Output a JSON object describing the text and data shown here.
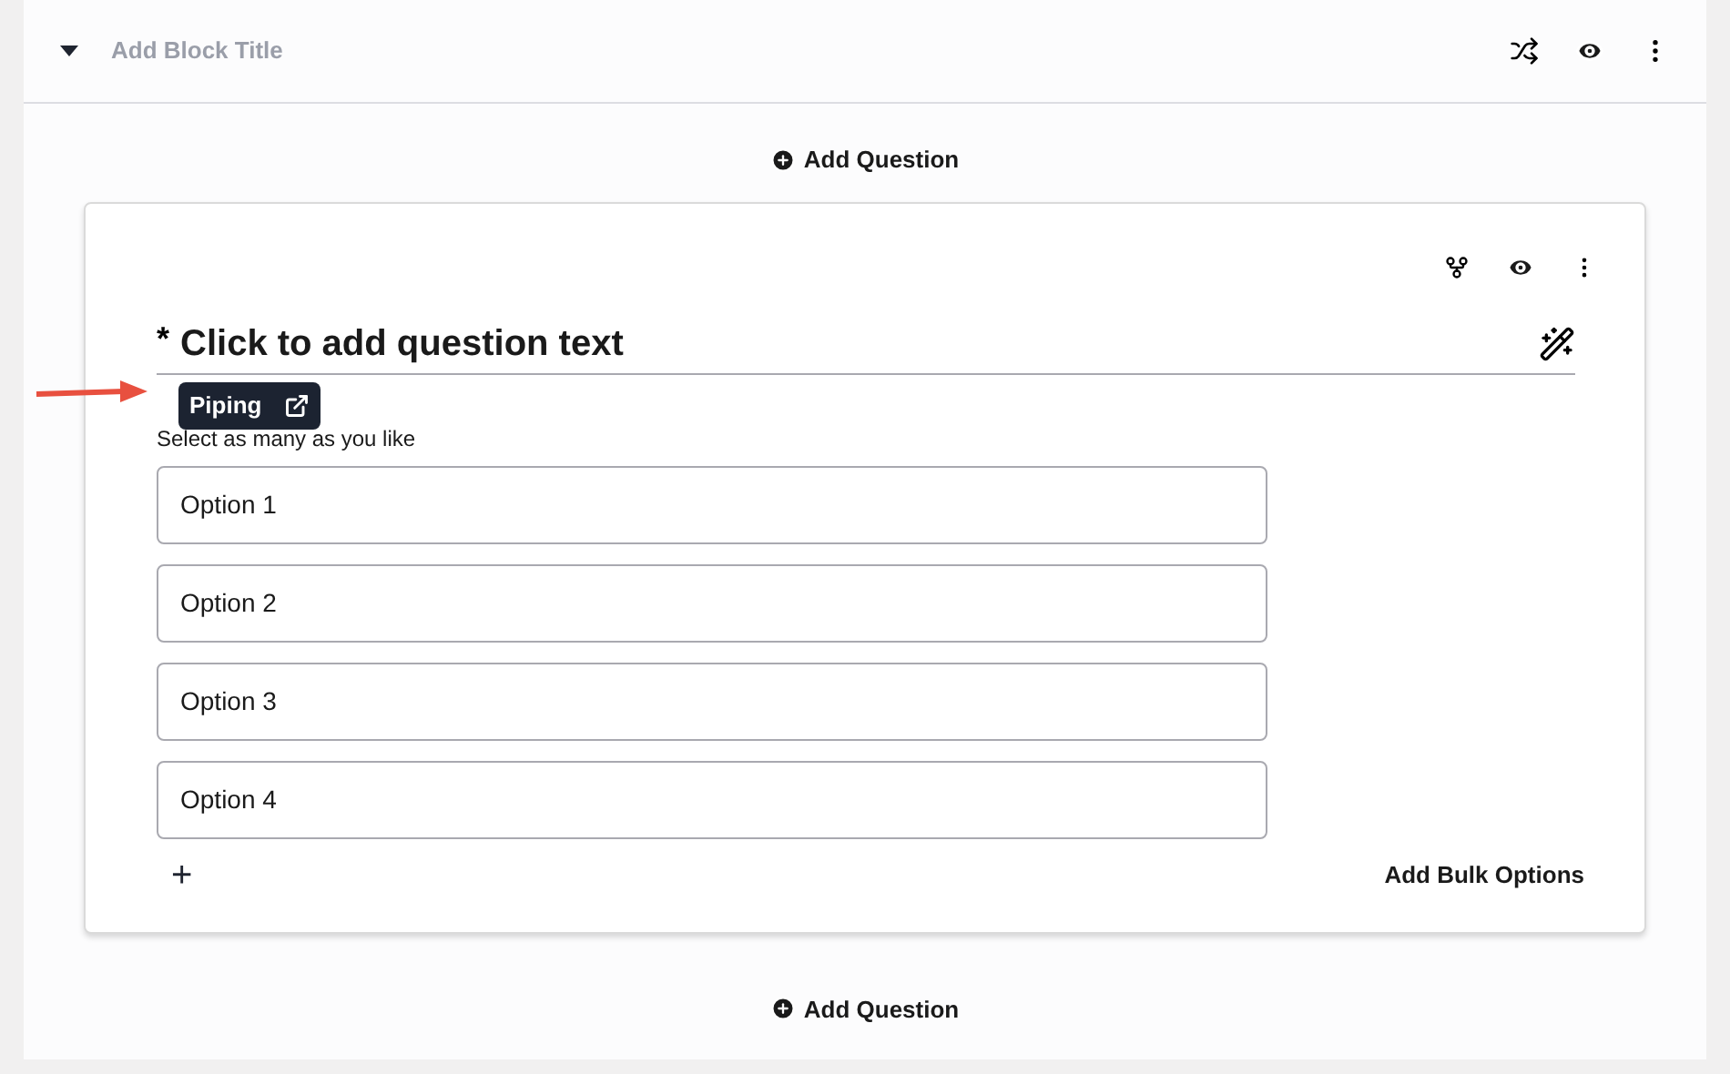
{
  "block": {
    "title_placeholder": "Add Block Title",
    "expanded": true
  },
  "add_question_top": "Add Question",
  "question": {
    "required_mark": "*",
    "text": "Click to add question text",
    "piping_tooltip": "Piping",
    "instruction": "Select as many as you like",
    "options": [
      {
        "label": "Option 1"
      },
      {
        "label": "Option 2"
      },
      {
        "label": "Option 3"
      },
      {
        "label": "Option 4"
      }
    ],
    "add_option": "+",
    "bulk_options": "Add Bulk Options"
  },
  "add_question_bottom": "Add Question"
}
